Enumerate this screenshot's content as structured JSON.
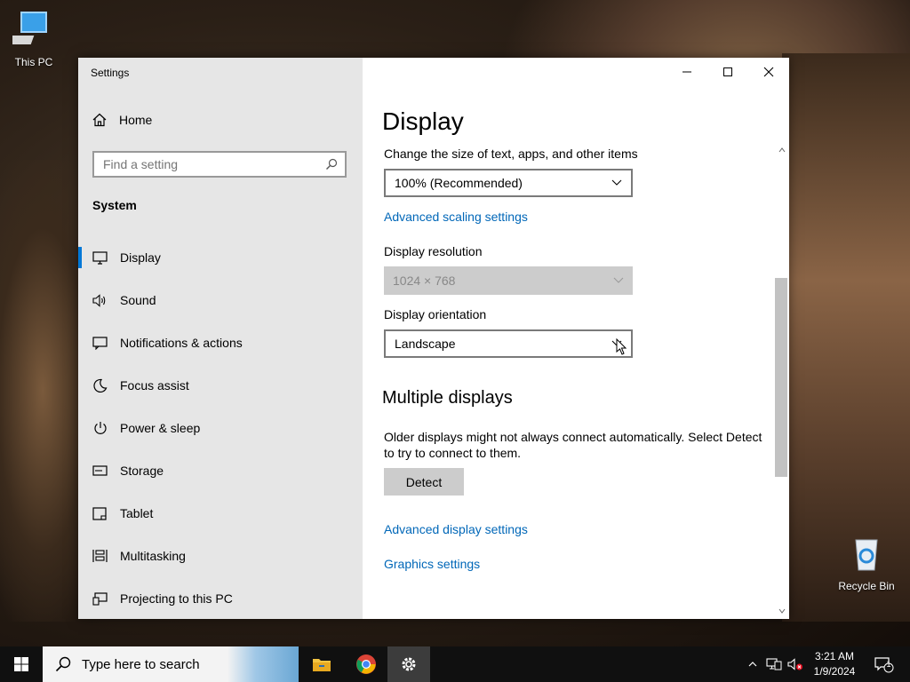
{
  "desktop": {
    "icons": [
      {
        "label": "This PC"
      },
      {
        "label": "Recycle Bin"
      }
    ]
  },
  "window": {
    "title": "Settings",
    "caption": {
      "minimize": "minimize-icon",
      "maximize": "maximize-icon",
      "close": "close-icon"
    }
  },
  "sidebar": {
    "home_label": "Home",
    "search_placeholder": "Find a setting",
    "section": "System",
    "items": [
      {
        "label": "Display",
        "icon": "monitor-icon",
        "active": true
      },
      {
        "label": "Sound",
        "icon": "speaker-icon"
      },
      {
        "label": "Notifications & actions",
        "icon": "notification-icon"
      },
      {
        "label": "Focus assist",
        "icon": "moon-icon"
      },
      {
        "label": "Power & sleep",
        "icon": "power-icon"
      },
      {
        "label": "Storage",
        "icon": "storage-icon"
      },
      {
        "label": "Tablet",
        "icon": "tablet-icon"
      },
      {
        "label": "Multitasking",
        "icon": "multitasking-icon"
      },
      {
        "label": "Projecting to this PC",
        "icon": "projecting-icon"
      }
    ]
  },
  "content": {
    "title": "Display",
    "scale_label": "Change the size of text, apps, and other items",
    "scale_value": "100% (Recommended)",
    "advanced_scaling_link": "Advanced scaling settings",
    "resolution_label": "Display resolution",
    "resolution_value": "1024 × 768",
    "orientation_label": "Display orientation",
    "orientation_value": "Landscape",
    "multiple_heading": "Multiple displays",
    "multiple_text": "Older displays might not always connect automatically. Select Detect to try to connect to them.",
    "detect_button": "Detect",
    "advanced_display_link": "Advanced display settings",
    "graphics_link": "Graphics settings"
  },
  "taskbar": {
    "search_placeholder": "Type here to search",
    "apps": [
      "file-explorer-icon",
      "chrome-icon",
      "settings-icon"
    ],
    "time": "3:21 AM",
    "date": "1/9/2024",
    "notification_count": "1"
  },
  "colors": {
    "accent": "#0078d7",
    "link": "#0067b8",
    "sidebar_bg": "#e6e6e6",
    "taskbar_bg": "#101010"
  }
}
